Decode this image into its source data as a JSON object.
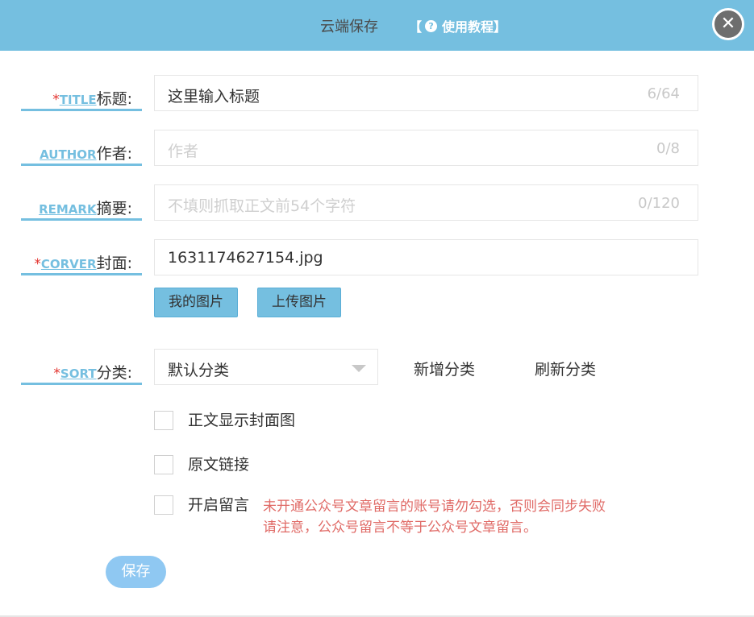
{
  "header": {
    "title": "云端保存",
    "help_link": "使用教程",
    "help_bracket_open": "【",
    "help_bracket_close": "】",
    "help_icon": "question-circle-icon",
    "close_icon": "close-icon",
    "close_glyph": "✕"
  },
  "form": {
    "title_field": {
      "required_mark": "*",
      "label_en": "TITLE",
      "label_zh": "标题",
      "colon": ":",
      "value": "这里输入标题",
      "counter": "6/64"
    },
    "author_field": {
      "label_en": "AUTHOR",
      "label_zh": "作者",
      "colon": ":",
      "placeholder": "作者",
      "counter": "0/8"
    },
    "remark_field": {
      "label_en": "REMARK",
      "label_zh": "摘要",
      "colon": ":",
      "placeholder": "不填则抓取正文前54个字符",
      "counter": "0/120"
    },
    "cover_field": {
      "required_mark": "*",
      "label_en": "CORVER",
      "label_zh": "封面",
      "colon": ":",
      "value": "1631174627154.jpg",
      "my_images_button": "我的图片",
      "upload_button": "上传图片"
    },
    "sort_field": {
      "required_mark": "*",
      "label_en": "SORT",
      "label_zh": "分类",
      "colon": ":",
      "selected": "默认分类",
      "add_category": "新增分类",
      "refresh_category": "刷新分类"
    },
    "options": [
      {
        "label": "正文显示封面图",
        "checked": false
      },
      {
        "label": "原文链接",
        "checked": false
      },
      {
        "label": "开启留言",
        "checked": false
      }
    ],
    "comment_warning": {
      "line1": "未开通公众号文章留言的账号请勿勾选，否则会同步失败",
      "line2": "请注意，公众号留言不等于公众号文章留言。"
    },
    "save_button": "保存"
  },
  "colors": {
    "header_bg": "#75bfe0",
    "accent": "#75bfe0",
    "required": "#e3322d",
    "warning": "#e06a66",
    "save_button": "#8fc8f2",
    "close_button": "#6e6e6e"
  }
}
